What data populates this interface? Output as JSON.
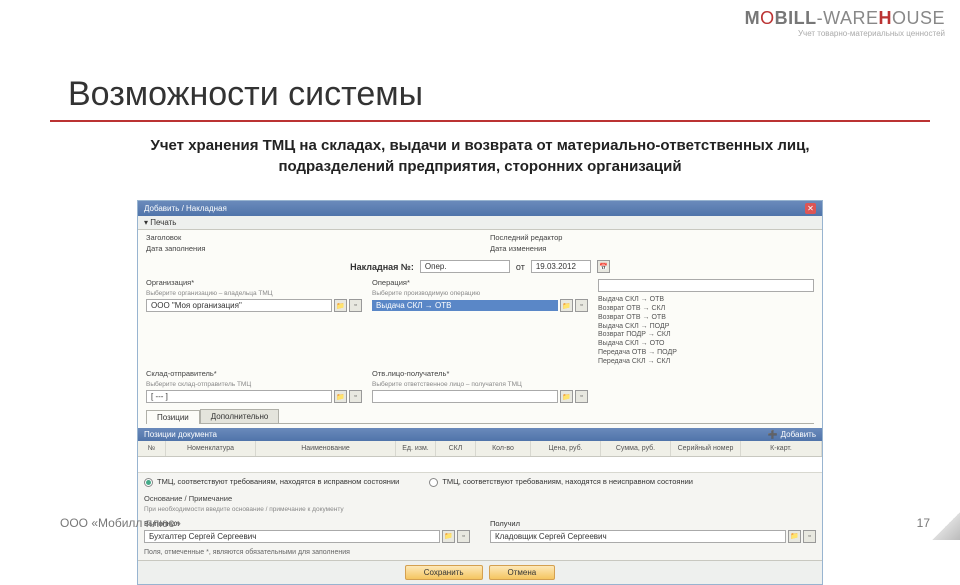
{
  "logo": {
    "pre": "M",
    "o": "O",
    "mid": "BILL",
    "dash": "-W",
    "are": "ARE",
    "h": "H",
    "ouse": "OUSE",
    "sub": "Учет товарно-материальных ценностей"
  },
  "title": "Возможности системы",
  "subhead_l1": "Учет хранения ТМЦ на складах, выдачи и возврата от материально-ответственных лиц,",
  "subhead_l2": "подразделений предприятия, сторонних организаций",
  "app": {
    "title": "Добавить / Накладная",
    "close": "✕",
    "toolbar_print": "▾ Печать",
    "meta": {
      "author_lbl": "Заголовок",
      "date_lbl": "Дата заполнения",
      "author2_lbl": "Последний редактор",
      "date2_lbl": "Дата изменения"
    },
    "doc": {
      "label": "Накладная №:",
      "num": "Опер.",
      "from": "от",
      "date": "19.03.2012"
    },
    "org": {
      "label": "Организация*",
      "hint": "Выберите организацию – владельца ТМЦ",
      "value": "ООО \"Моя организация\""
    },
    "op": {
      "label": "Операция*",
      "hint": "Выберите производимую операцию",
      "selected": "Выдача СКЛ → ОТВ",
      "list": [
        "Выдача СКЛ → ОТВ",
        "Возврат ОТВ → СКЛ",
        "Возврат ОТВ → ОТВ",
        "Выдача СКЛ → ПОДР",
        "Возврат ПОДР → СКЛ",
        "Выдача СКЛ → ОТО",
        "Передача ОТВ → ПОДР",
        "Передача СКЛ → СКЛ"
      ]
    },
    "wh": {
      "label": "Склад-отправитель*",
      "hint": "Выберите склад-отправитель ТМЦ",
      "value": "[ --- ]"
    },
    "otv": {
      "label": "Отв.лицо-получатель*",
      "hint": "Выберите ответственное лицо – получателя ТМЦ",
      "value": ""
    },
    "tabs": [
      "Позиции",
      "Дополнительно"
    ],
    "section": "Позиции документа",
    "add": "Добавить",
    "grid": [
      "№",
      "Номенклатура",
      "Наименование",
      "Ед. изм.",
      "СКЛ",
      "Кол-во",
      "Цена, руб.",
      "Сумма, руб.",
      "Серийный номер",
      "К-карт."
    ],
    "radio1": "ТМЦ, соответствуют требованиям, находятся в исправном состоянии",
    "radio2": "ТМЦ, соответствуют требованиям, находятся в неисправном состоянии",
    "basis_lbl": "Основание / Примечание",
    "basis_hint": "При необходимости введите основание / примечание к документу",
    "sign1_lbl": "Выполнил",
    "sign1_val": "Бухгалтер Сергей Сергеевич",
    "sign2_lbl": "Получил",
    "sign2_val": "Кладовщик Сергей Сергеевич",
    "note": "Поля, отмеченные *, являются обязательными для заполнения",
    "btn_save": "Сохранить",
    "btn_cancel": "Отмена"
  },
  "footer": {
    "left": "ООО «Мобилл плюс»",
    "right": "17"
  }
}
